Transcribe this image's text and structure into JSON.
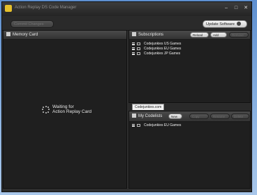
{
  "window": {
    "title": "Action Replay DS Code Manager",
    "controls": [
      "–",
      "□",
      "✕"
    ]
  },
  "toolbar": {
    "commit_label": "Commit Changes",
    "update_label": "Update Software"
  },
  "memory_card": {
    "header": "Memory Card",
    "status_line1": "Waiting for",
    "status_line2": "Action Replay Card"
  },
  "subscriptions": {
    "header": "Subscriptions",
    "buttons": {
      "reload": "Reload",
      "add": "Add",
      "remove": "Remove"
    },
    "items": [
      {
        "label": "Codejunkies US Games"
      },
      {
        "label": "Codejunkies EU Games"
      },
      {
        "label": "Codejunkies JP Games"
      }
    ]
  },
  "tabs": [
    {
      "label": "Codejunkies.com"
    }
  ],
  "codelists": {
    "header": "My Codelists",
    "buttons": {
      "new": "New",
      "copy": "Copy",
      "rename": "Rename",
      "delete": "Delete"
    },
    "items": [
      {
        "label": "Codejunkies EU Games"
      }
    ]
  },
  "colors": {
    "accent": "#e6c02a",
    "panel_bg": "#1f1f1f",
    "window_bg": "#2e2e2e"
  }
}
